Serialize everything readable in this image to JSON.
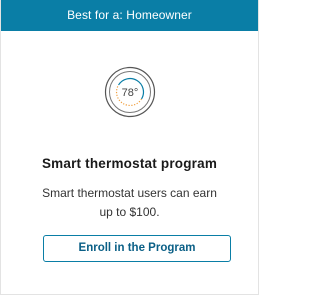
{
  "banner": {
    "text": "Best for a: Homeowner",
    "color": "#0a7ea6"
  },
  "thermostat": {
    "icon": "thermostat-icon",
    "temperature": "78°"
  },
  "program": {
    "title": "Smart thermostat program",
    "description": "Smart thermostat users can earn up to $100."
  },
  "button": {
    "label": "Enroll in the Program"
  },
  "colors": {
    "accent": "#0a7ea6",
    "button_text": "#0a5f86",
    "title_text": "#1a1a1a"
  }
}
